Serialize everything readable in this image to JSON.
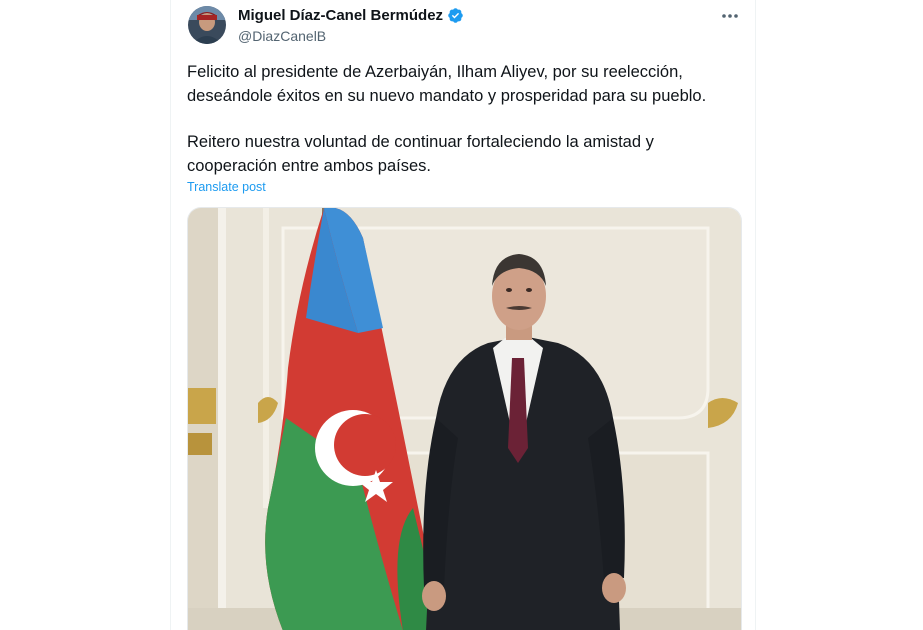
{
  "tweet": {
    "author": {
      "name": "Miguel Díaz-Canel Bermúdez",
      "handle": "@DiazCanelB",
      "verified": true,
      "verified_color": "#1d9bf0"
    },
    "paragraphs": [
      "Felicito al presidente de Azerbaiyán, Ilham Aliyev, por su reelección, deseándole éxitos en su nuevo mandato y prosperidad para su pueblo.",
      "Reitero nuestra voluntad de continuar fortaleciendo la amistad y cooperación entre ambos países."
    ],
    "translate_label": "Translate post",
    "more_icon": "ellipsis-icon",
    "link_color": "#1d9bf0"
  }
}
